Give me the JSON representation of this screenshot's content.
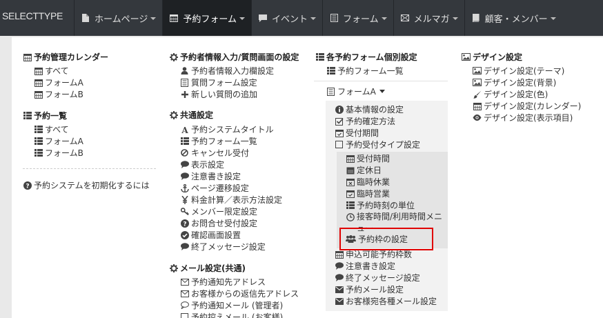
{
  "brand": "SELECTTYPE",
  "nav": [
    {
      "label": "ホームページ",
      "icon": "page-icon"
    },
    {
      "label": "予約フォーム",
      "icon": "calendar-icon",
      "active": true
    },
    {
      "label": "イベント",
      "icon": "chat-icon"
    },
    {
      "label": "フォーム",
      "icon": "form-icon"
    },
    {
      "label": "メルマガ",
      "icon": "mail-icon"
    },
    {
      "label": "顧客・メンバー",
      "icon": "book-icon"
    }
  ],
  "col1": {
    "calendar_head": "予約管理カレンダー",
    "calendar_items": [
      "すべて",
      "フォームA",
      "フォームB"
    ],
    "list_head": "予約一覧",
    "list_items": [
      "すべて",
      "フォームA",
      "フォームB"
    ],
    "init_link": "予約システムを初期化するには"
  },
  "col2": {
    "applicant_head": "予約者情報入力/質問画面の設定",
    "applicant_items": [
      "予約者情報入力欄設定",
      "質問フォーム設定",
      "新しい質問の追加"
    ],
    "common_head": "共通設定",
    "common_items": [
      "予約システムタイトル",
      "予約フォーム一覧",
      "キャンセル受付",
      "表示設定",
      "注意書き設定",
      "ページ遷移設定",
      "料金計算／表示方法設定",
      "メンバー限定設定",
      "お問合せ受付設定",
      "確認画面設置",
      "終了メッセージ設定"
    ],
    "mail_head": "メール設定(共通)",
    "mail_items": [
      "予約通知先アドレス",
      "お客様からの返信先アドレス",
      "予約通知メール (管理者)",
      "予約控えメール (お客様)"
    ]
  },
  "col3": {
    "head": "各予約フォーム個別設定",
    "forms_list": "予約フォーム一覧",
    "form_dropdown": "フォームA",
    "form_items": [
      "基本情報の設定",
      "予約確定方法",
      "受付期間",
      "予約受付タイプ設定"
    ],
    "sub_items": [
      "受付時間",
      "定休日",
      "臨時休業",
      "臨時営業",
      "予約時刻の単位",
      "接客時間/利用時間メニュー",
      "予約枠の設定"
    ],
    "more_items": [
      "申込可能予約枠数",
      "注意書き設定",
      "終了メッセージ設定",
      "予約メール設定",
      "お客様宛各種メール設定"
    ]
  },
  "col4": {
    "head": "デザイン設定",
    "items": [
      "デザイン設定(テーマ)",
      "デザイン設定(背景)",
      "デザイン設定(色)",
      "デザイン設定(カレンダー)",
      "デザイン設定(表示項目)"
    ]
  }
}
